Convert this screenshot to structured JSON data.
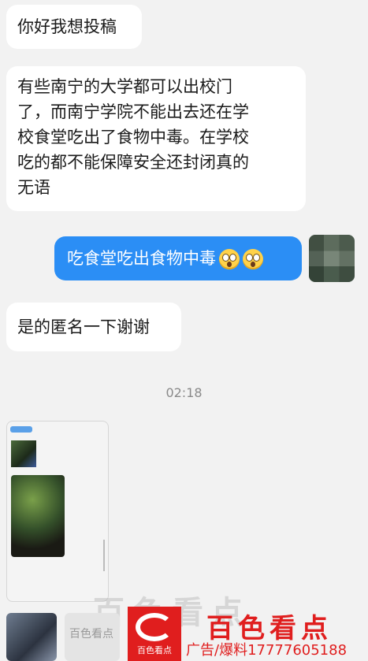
{
  "messages": {
    "received_1": "你好我想投稿",
    "received_2_lines": [
      "有些南宁的大学都可以出校门",
      "了，而南宁学院不能出去还在学",
      "校食堂吃出了食物中毒。在学校",
      "吃的都不能保障安全还封闭真的",
      "无语"
    ],
    "sent_1": "吃食堂吃出食物中毒",
    "received_3": "是的匿名一下谢谢",
    "timestamp": "02:18"
  },
  "footer": {
    "logo_caption": "百色看点",
    "brand_name": "百色看点",
    "hotline": "广告/爆料17777605188",
    "watermark": "百色看点",
    "tile_caption": "百色看点"
  },
  "colors": {
    "sent_bubble": "#2b8ef5",
    "brand_red": "#e01e1e"
  },
  "icons": {
    "emoji": "astonished-face",
    "avatar": "blurred-user-avatar"
  }
}
